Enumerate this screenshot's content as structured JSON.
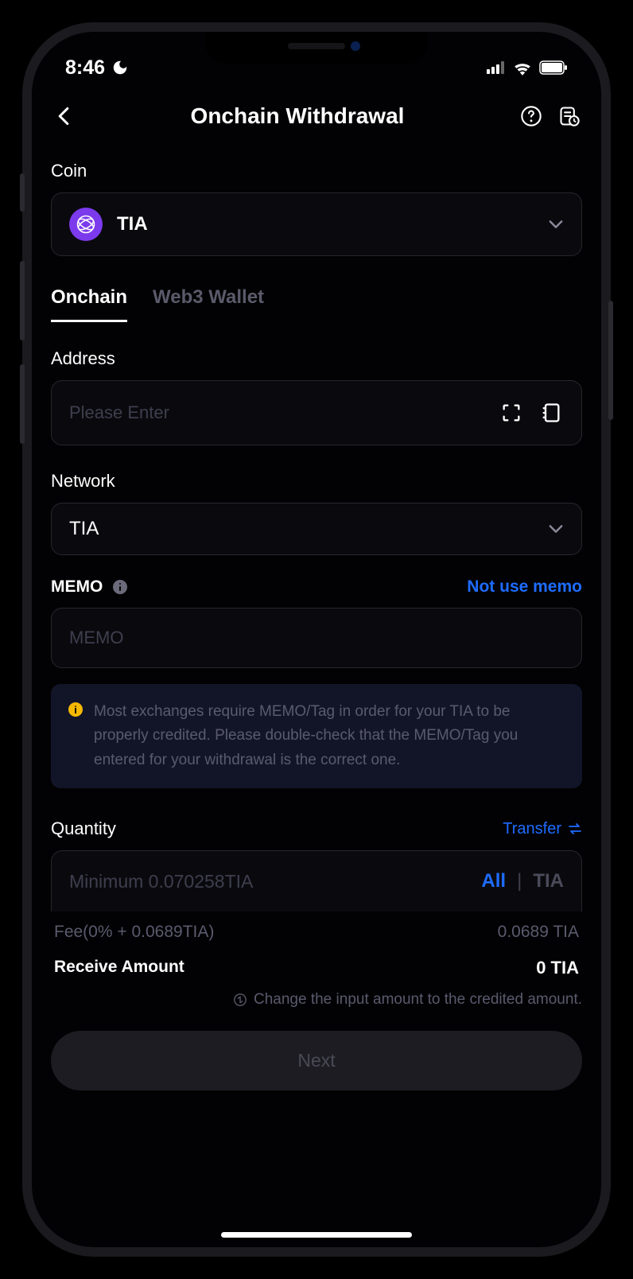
{
  "status": {
    "time": "8:46"
  },
  "header": {
    "title": "Onchain Withdrawal"
  },
  "coin": {
    "label": "Coin",
    "selected": "TIA"
  },
  "tabs": {
    "onchain": "Onchain",
    "web3": "Web3 Wallet"
  },
  "address": {
    "label": "Address",
    "placeholder": "Please Enter"
  },
  "network": {
    "label": "Network",
    "selected": "TIA"
  },
  "memo": {
    "label": "MEMO",
    "link": "Not use memo",
    "placeholder": "MEMO",
    "warning": "Most exchanges require MEMO/Tag in order for your TIA to be properly credited. Please double-check that the MEMO/Tag you entered for your withdrawal is the correct one."
  },
  "quantity": {
    "label": "Quantity",
    "transfer": "Transfer",
    "placeholder": "Minimum 0.070258TIA",
    "all": "All",
    "unit": "TIA"
  },
  "fee": {
    "label": "Fee(0% + 0.0689TIA)",
    "value": "0.0689 TIA"
  },
  "receive": {
    "label": "Receive Amount",
    "value": "0 TIA"
  },
  "hint": "Change the input amount to the credited amount.",
  "next": "Next"
}
